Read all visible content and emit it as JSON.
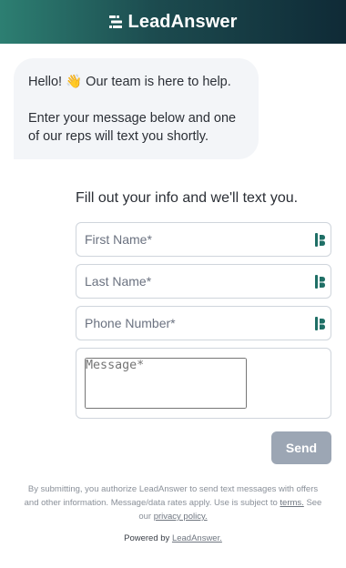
{
  "header": {
    "brand": "LeadAnswer",
    "logo_icon": "leadanswer-logo-icon",
    "gradient_start": "#2d7f72",
    "gradient_end": "#0f2a36"
  },
  "greeting": {
    "line1": "Hello! 👋 Our team is here to help.",
    "line2": "Enter your message below and one of our reps will text you shortly."
  },
  "form": {
    "title": "Fill out your info and we'll text you.",
    "first_name_placeholder": "First Name*",
    "last_name_placeholder": "Last Name*",
    "phone_placeholder": "Phone Number*",
    "message_placeholder": "Message*",
    "field_icon": "autofill-extension-icon",
    "send_label": "Send",
    "send_color": "#9ca6b4"
  },
  "footer": {
    "disclaimer_prefix": "By submitting, you authorize LeadAnswer to send text messages with offers and other information. Message/data rates apply. Use is subject to",
    "terms_link": "terms.",
    "see_our": "See our",
    "privacy_link": "privacy policy.",
    "powered_prefix": "Powered by",
    "powered_link": "LeadAnswer."
  }
}
